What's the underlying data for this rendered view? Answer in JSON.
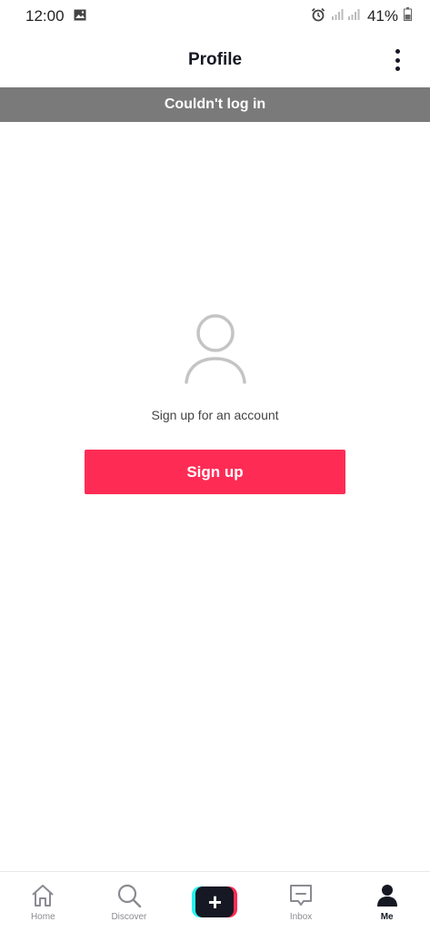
{
  "status_bar": {
    "time": "12:00",
    "battery": "41%",
    "icons": [
      "image-icon",
      "alarm-icon",
      "signal-icon",
      "battery-icon"
    ]
  },
  "header": {
    "title": "Profile",
    "menu_icon": "more-vertical-icon"
  },
  "banner": {
    "text": "Couldn't log in",
    "background": "#7a7a7a"
  },
  "main": {
    "avatar_icon": "user-avatar-icon",
    "prompt": "Sign up for an account",
    "signup_label": "Sign up",
    "accent": "#fe2c55"
  },
  "tabs": [
    {
      "label": "Home",
      "icon": "home-icon",
      "active": false
    },
    {
      "label": "Discover",
      "icon": "search-icon",
      "active": false
    },
    {
      "label": "",
      "icon": "create-plus-icon",
      "active": false
    },
    {
      "label": "Inbox",
      "icon": "inbox-icon",
      "active": false
    },
    {
      "label": "Me",
      "icon": "person-icon",
      "active": true
    }
  ]
}
